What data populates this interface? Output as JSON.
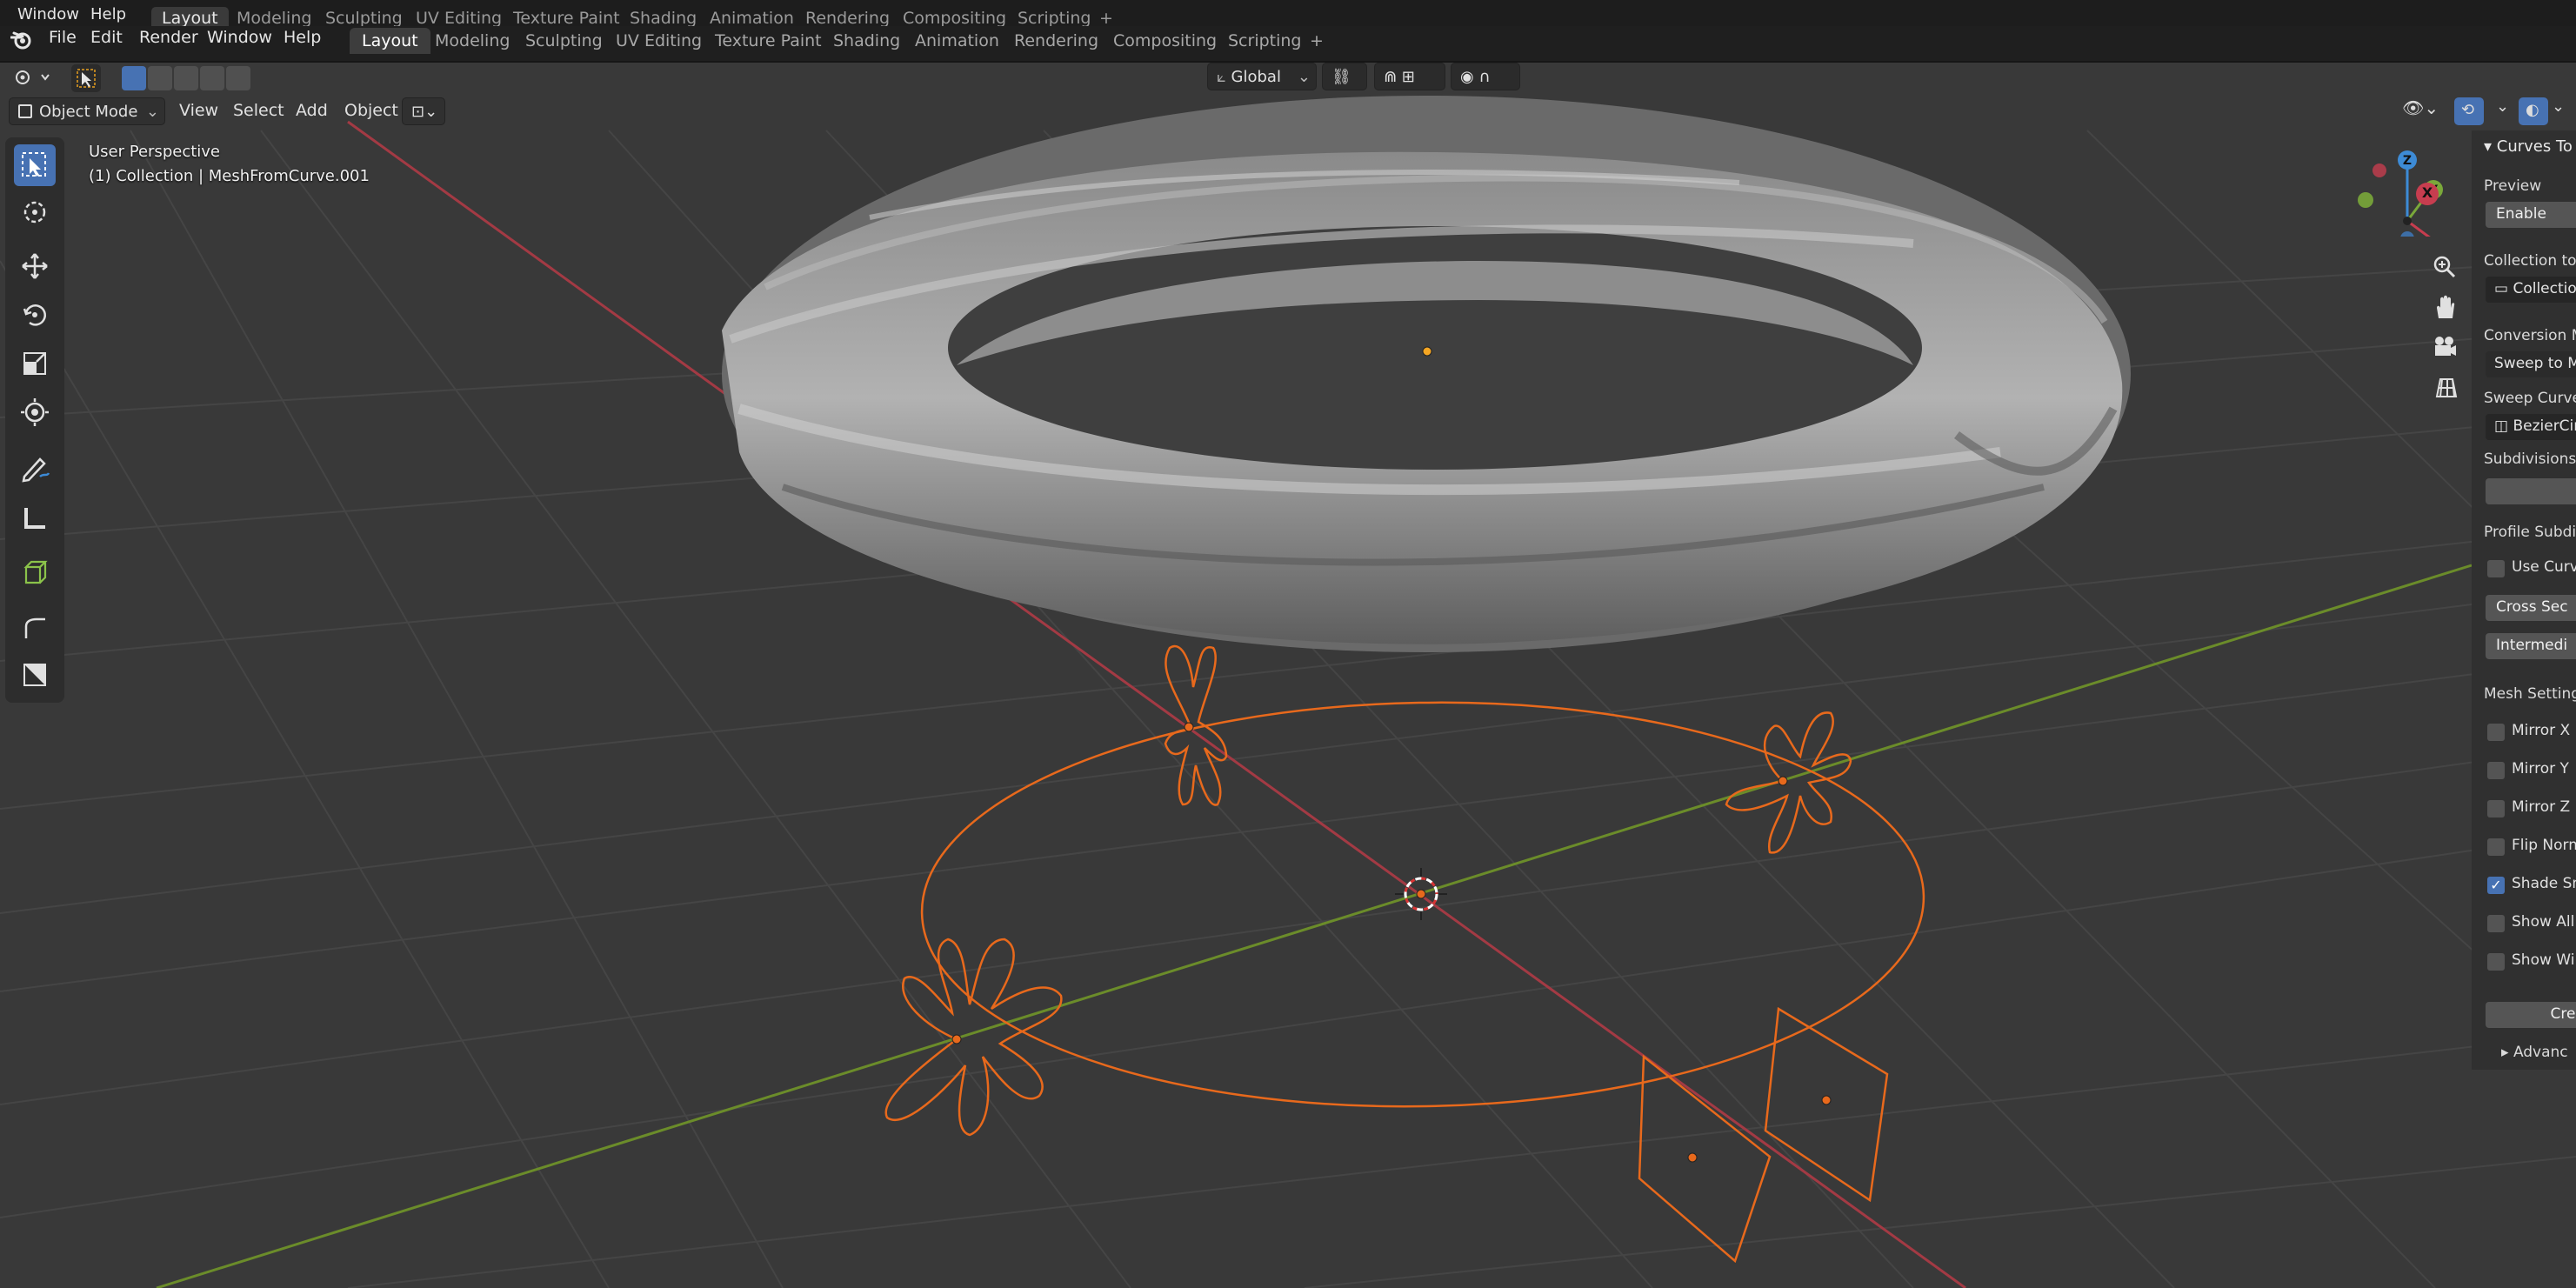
{
  "ghost_bar": {
    "menus": [
      "Window",
      "Help"
    ],
    "tabs": [
      "Layout",
      "Modeling",
      "Sculpting",
      "UV Editing",
      "Texture Paint",
      "Shading",
      "Animation",
      "Rendering",
      "Compositing",
      "Scripting"
    ]
  },
  "topbar": {
    "menus": [
      "File",
      "Edit",
      "Render",
      "Window",
      "Help"
    ],
    "tabs": [
      "Layout",
      "Modeling",
      "Sculpting",
      "UV Editing",
      "Texture Paint",
      "Shading",
      "Animation",
      "Rendering",
      "Compositing",
      "Scripting"
    ],
    "active_tab": "Layout",
    "add_tab_symbol": "+"
  },
  "tool_header": {
    "transform_orientation": "Global"
  },
  "viewport_header": {
    "mode": "Object Mode",
    "menus": [
      "View",
      "Select",
      "Add",
      "Object"
    ]
  },
  "viewport_overlay": {
    "perspective": "User Perspective",
    "collection_info": "(1) Collection | MeshFromCurve.001"
  },
  "gizmo": {
    "axes": [
      "Z",
      "Y",
      "X"
    ]
  },
  "npanel": {
    "title": "Curves To",
    "preview_label": "Preview",
    "enable_button": "Enable",
    "collection_label": "Collection to",
    "collection_value": "Collection",
    "conversion_label": "Conversion M",
    "conversion_value": "Sweep to M",
    "sweep_curve_label": "Sweep Curve",
    "sweep_curve_value": "BezierCir",
    "subdivisions_label": "Subdivisions",
    "profile_label": "Profile Subdiv",
    "use_curve_label": "Use Curv",
    "cross_section_button": "Cross Sec",
    "intermediate_button": "Intermedi",
    "mesh_settings_label": "Mesh Setting",
    "checkboxes": [
      {
        "label": "Mirror X",
        "checked": false
      },
      {
        "label": "Mirror Y",
        "checked": false
      },
      {
        "label": "Mirror Z",
        "checked": false
      },
      {
        "label": "Flip Norm",
        "checked": false
      },
      {
        "label": "Shade Sm",
        "checked": true
      },
      {
        "label": "Show All",
        "checked": false
      },
      {
        "label": "Show Wi",
        "checked": false
      }
    ],
    "create_button": "Cre",
    "advanced_label": "Advanc"
  },
  "colors": {
    "viewport_bg": "#393939",
    "grid": "#454545",
    "x_axis": "#a33a44",
    "y_axis": "#6b8c2a",
    "selection": "#e8691c",
    "active_blue": "#4772b3",
    "mesh": "#9a9a9a"
  },
  "icons": {
    "editor_type": "blender-logo-icon",
    "gizmo_tools": [
      "zoom-icon",
      "hand-pan-icon",
      "camera-icon",
      "grid-ortho-icon"
    ],
    "left_tools": [
      "select-box-icon",
      "cursor-icon",
      "move-icon",
      "rotate-icon",
      "scale-icon",
      "transform-icon",
      "annotate-icon",
      "measure-icon",
      "add-cube-icon",
      "curve-tool-icon",
      "scale-cage-icon"
    ]
  }
}
